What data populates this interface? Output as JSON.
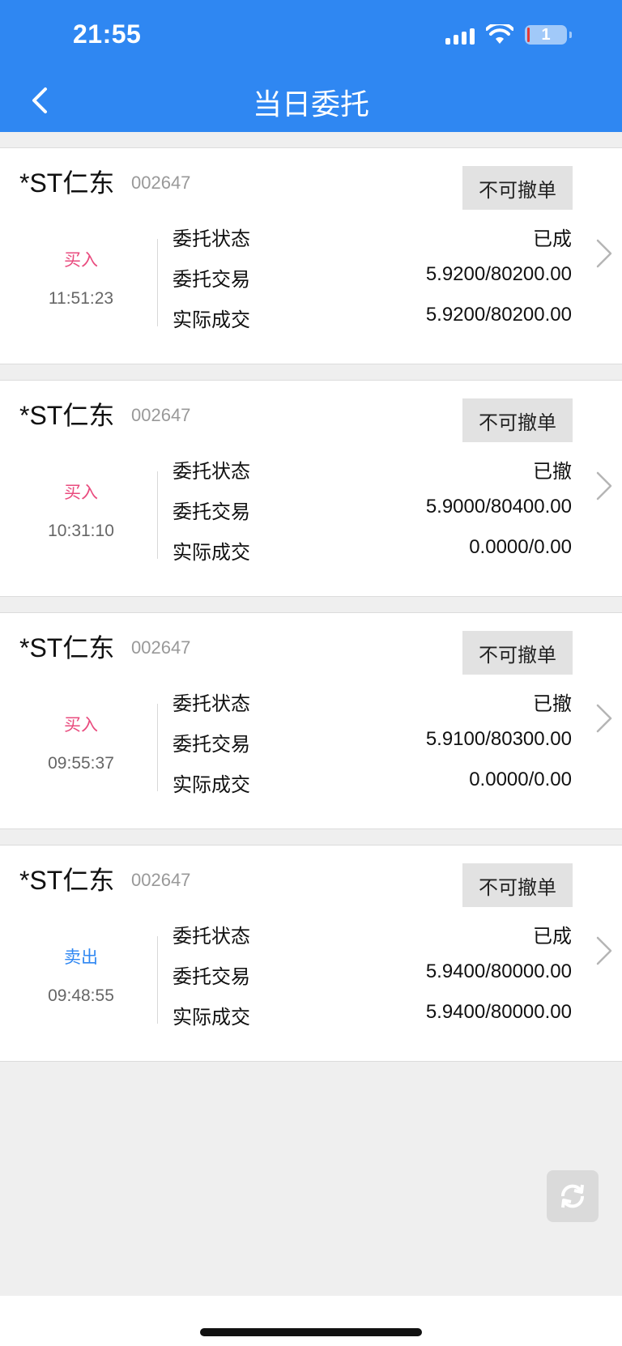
{
  "status_bar": {
    "time": "21:55",
    "battery": "1"
  },
  "header": {
    "title": "当日委托"
  },
  "labels": {
    "status": "委托状态",
    "order": "委托交易",
    "filled": "实际成交"
  },
  "colors": {
    "header_bg": "#2f87f2",
    "buy": "#e94b7e",
    "sell": "#2f87f2"
  },
  "orders": [
    {
      "name": "*ST仁东",
      "code": "002647",
      "cancel_label": "不可撤单",
      "side": "买入",
      "side_kind": "buy",
      "time": "11:51:23",
      "status": "已成",
      "order": "5.9200/80200.00",
      "filled": "5.9200/80200.00"
    },
    {
      "name": "*ST仁东",
      "code": "002647",
      "cancel_label": "不可撤单",
      "side": "买入",
      "side_kind": "buy",
      "time": "10:31:10",
      "status": "已撤",
      "order": "5.9000/80400.00",
      "filled": "0.0000/0.00"
    },
    {
      "name": "*ST仁东",
      "code": "002647",
      "cancel_label": "不可撤单",
      "side": "买入",
      "side_kind": "buy",
      "time": "09:55:37",
      "status": "已撤",
      "order": "5.9100/80300.00",
      "filled": "0.0000/0.00"
    },
    {
      "name": "*ST仁东",
      "code": "002647",
      "cancel_label": "不可撤单",
      "side": "卖出",
      "side_kind": "sell",
      "time": "09:48:55",
      "status": "已成",
      "order": "5.9400/80000.00",
      "filled": "5.9400/80000.00"
    }
  ]
}
